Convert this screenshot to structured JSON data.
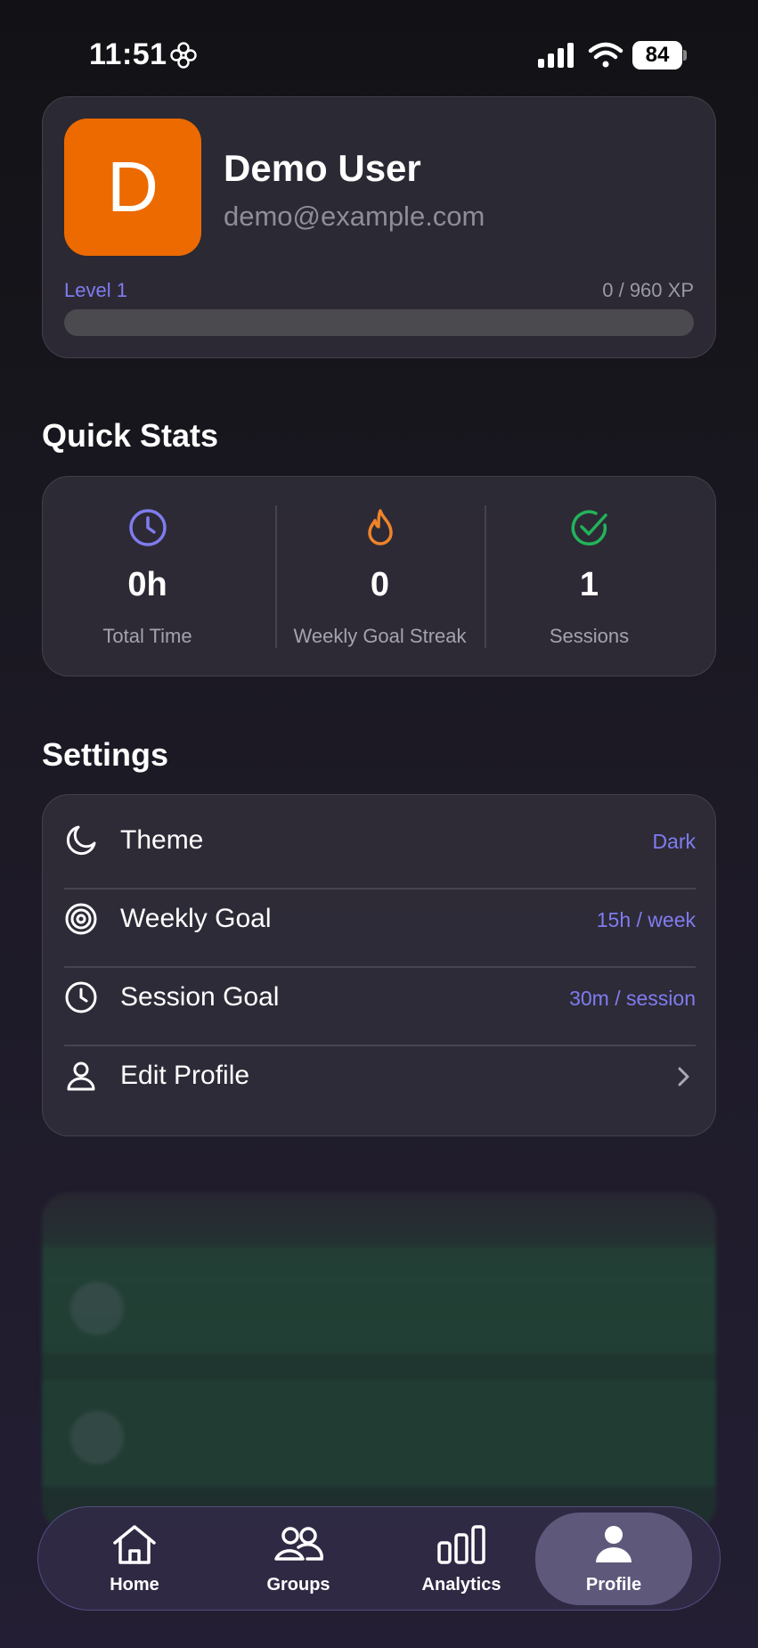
{
  "status_bar": {
    "time": "11:51",
    "battery": "84"
  },
  "profile": {
    "avatar_initial": "D",
    "name": "Demo User",
    "email": "demo@example.com",
    "level": "Level 1",
    "xp": "0 / 960 XP",
    "xp_progress": 0,
    "avatar_color": "#ec6a00"
  },
  "quick_stats": {
    "title": "Quick Stats",
    "items": [
      {
        "icon": "clock-icon",
        "value": "0h",
        "label": "Total Time",
        "color": "#7f7cf0"
      },
      {
        "icon": "flame-icon",
        "value": "0",
        "label": "Weekly Goal Streak",
        "color": "#f0832a"
      },
      {
        "icon": "check-circle-icon",
        "value": "1",
        "label": "Sessions",
        "color": "#22b35a"
      }
    ]
  },
  "settings": {
    "title": "Settings",
    "rows": [
      {
        "icon": "moon-icon",
        "label": "Theme",
        "value": "Dark"
      },
      {
        "icon": "target-icon",
        "label": "Weekly Goal",
        "value": "15h / week"
      },
      {
        "icon": "clock-icon",
        "label": "Session Goal",
        "value": "30m / session"
      },
      {
        "icon": "user-icon",
        "label": "Edit Profile",
        "value": ""
      }
    ]
  },
  "tab_bar": {
    "tabs": [
      {
        "icon": "home-icon",
        "label": "Home"
      },
      {
        "icon": "groups-icon",
        "label": "Groups"
      },
      {
        "icon": "analytics-icon",
        "label": "Analytics"
      },
      {
        "icon": "profile-icon",
        "label": "Profile",
        "active": true
      }
    ]
  },
  "colors": {
    "accent": "#7f7cf0"
  }
}
